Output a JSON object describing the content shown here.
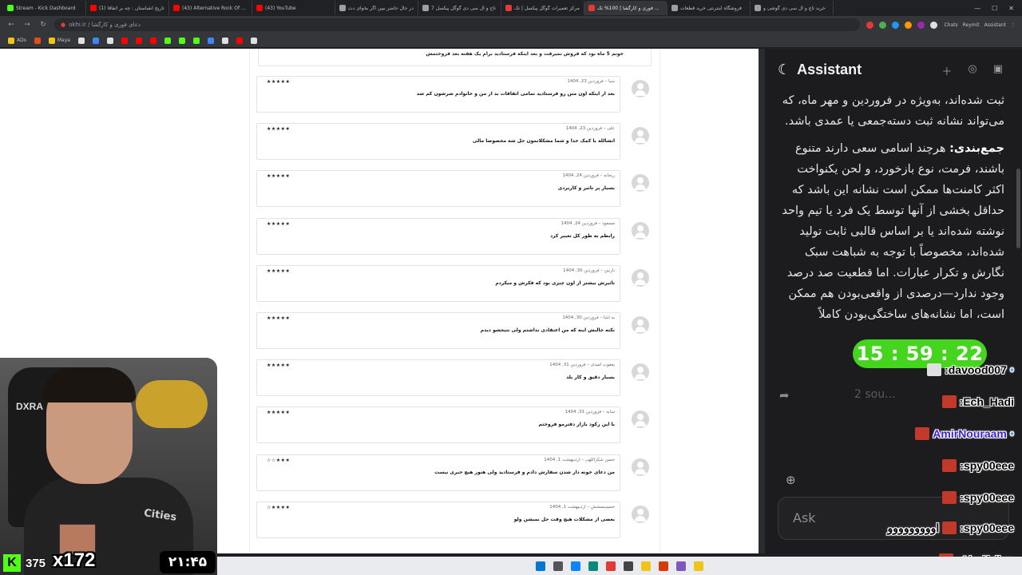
{
  "tabs": [
    {
      "title": "Stream - Kick Dashboard",
      "color": "#53fc18"
    },
    {
      "title": "(1) تاریخ انقباستان : چه بر اتفاقا",
      "color": "#ff0000"
    },
    {
      "title": "(43) Alternative Rock Of The",
      "color": "#ff0000"
    },
    {
      "title": "(43) YouTube",
      "color": "#ff0000"
    },
    {
      "title": "در حال حاضر بیین اگر بخوای دت",
      "color": "#9aa0a6"
    },
    {
      "title": "تاج و ال سی دی گوگل پیکسل 7",
      "color": "#9aa0a6"
    },
    {
      "title": "مرکز تعمیرات گوگل پیکسل | تک",
      "color": "#e53935"
    },
    {
      "title": "دعای فوری و کارگشا | 100% تک",
      "color": "#e53935",
      "active": true
    },
    {
      "title": "فروشگاه اینترنتی خرید قطعات",
      "color": "#9aa0a6"
    },
    {
      "title": "خرید تاچ و ال سی دی گوشی و",
      "color": "#9aa0a6"
    }
  ],
  "toolbar": {
    "url": "okhi.ir / دعای فوری و کارگشا",
    "chats_label": "Chats",
    "reymit_label": "Reymit",
    "assistant_label": "Assistant"
  },
  "bookmarks": [
    {
      "label": "ADs",
      "color": "#f0c419"
    },
    {
      "label": "",
      "color": "#e64a19"
    },
    {
      "label": "Maya",
      "color": "#f0c419"
    },
    {
      "label": "",
      "color": "#e0e0e0"
    },
    {
      "label": "",
      "color": "#4285f4"
    },
    {
      "label": "",
      "color": "#e0e0e0"
    },
    {
      "label": "",
      "color": "#ff0000"
    },
    {
      "label": "",
      "color": "#ff0000"
    },
    {
      "label": "",
      "color": "#ff0000"
    },
    {
      "label": "",
      "color": "#53fc18"
    },
    {
      "label": "",
      "color": "#53fc18"
    },
    {
      "label": "",
      "color": "#53fc18"
    },
    {
      "label": "",
      "color": "#4285f4"
    },
    {
      "label": "",
      "color": "#e0e0e0"
    },
    {
      "label": "",
      "color": "#ff0000"
    },
    {
      "label": "",
      "color": "#e0e0e0"
    }
  ],
  "page": {
    "top_comment": "خونم 5 ماه بود که فروش نمیرفت و بعد اینکه فرستادید برام یک هفته بعد فروختمش",
    "comments": [
      {
        "meta": "سیا – فروردین 23, 1404",
        "stars": "★★★★★",
        "text": "بعد از اینکه اون متن رو فرستادید تمامی اتفاقات بد از من و خانوادم شرشون کم شد"
      },
      {
        "meta": "علی – فروردین 23, 1404",
        "stars": "★★★★★",
        "text": "انشالله با کمک خدا و شما مشکلاتمون حل شه مخصوصا مالی"
      },
      {
        "meta": "ریحانه – فروردین 24, 1404",
        "stars": "★★★★★",
        "text": "بسیار پر تاثیر و کاربردی"
      },
      {
        "meta": "مسعود – فروردین 24, 1404",
        "stars": "★★★★★",
        "text": "رابطم به طور کل تغییر کرد"
      },
      {
        "meta": "نازنین – فروردین 30, 1404",
        "stars": "★★★★★",
        "text": "تاثیرش بیشتر از اون چیزی بود که فکرش و میکردم"
      },
      {
        "meta": "به اشا – فروردین 30, 1404",
        "stars": "★★★★★",
        "text": "نکته جالبش اینه که من اعتقادی نداشتم ولی نتیجشو دیدم"
      },
      {
        "meta": "یعقوب امیدی – فروردین 31, 1404",
        "stars": "★★★★★",
        "text": "بسیار دقیق و کار بلد"
      },
      {
        "meta": "سایه – فروردین 31, 1404",
        "stars": "★★★★★",
        "text": "با این رکود بازار دفترمو فروختم"
      },
      {
        "meta": "حسن شکراللهی – اردیبهشت 1, 1404",
        "stars": "☆☆★★★",
        "text": "من دعای خونه دار شدن سفارش دادم و فرستادید ولی هنوز هیچ خبری نیست"
      },
      {
        "meta": "خسینبسشش – اردیبهشت 1, 1404",
        "stars": "☆★★★★",
        "text": "بعضی از مشکلات هیچ وقت حل نمیشن ولو"
      }
    ]
  },
  "assistant": {
    "title": "Assistant",
    "para1": "ثبت شده‌اند، به‌ویژه در فروردین و مهر ماه، که می‌تواند نشانه ثبت دسته‌جمعی یا عمدی باشد.",
    "para2_label": "جمع‌بندی:",
    "para2": " هرچند اسامی سعی دارند متنوع باشند، فرمت، نوع بازخورد، و لحن یکنواخت اکثر کامنت‌ها ممکن است نشانه این باشد که حداقل بخشی از آنها توسط یک فرد یا تیم واحد نوشته شده‌اند یا بر اساس قالبی ثابت تولید شده‌اند، مخصوصاً با توجه به شباهت سبک نگارش و تکرار عبارات. اما قطعیت صد درصد وجود ندارد—درصدی از واقعی‌بودن هم ممکن است، اما نشانه‌های ساختگی‌بودن کاملاً",
    "sources": "2 sou...",
    "input_placeholder": "Ask"
  },
  "timer": "15 : 59 : 22",
  "chat": [
    {
      "name": ":davood007",
      "badge": true,
      "color": "#e0e0e0"
    },
    {
      "name": ":Ech_Hadi",
      "badge": false,
      "color": "#c0392b"
    },
    {
      "name": "AmirNouraam",
      "badge": true,
      "color": "#c0392b",
      "purple": true
    },
    {
      "name": ":spy00eee",
      "badge": false,
      "color": "#c0392b"
    },
    {
      "name": ":spy00eee",
      "badge": false,
      "color": "#c0392b"
    },
    {
      "name": ":spy00eee",
      "badge": false,
      "color": "#c0392b",
      "prefix": "اووووووووو"
    },
    {
      "name": ":Abolfzlkm",
      "badge": false,
      "color": "#c0392b"
    }
  ],
  "stream": {
    "viewer_count": "375",
    "multiplier": "x172",
    "clock": "۲۱:۴۵",
    "kick_letter": "K",
    "chair_text": "DXRA",
    "shirt_text": "Cities"
  },
  "taskbar_icons": [
    "#0078d4",
    "#555",
    "#0a84ff",
    "#0b8a7a",
    "#e53935",
    "#444",
    "#f0c419",
    "#d83b01",
    "#7e57c2",
    "#f0c419"
  ]
}
